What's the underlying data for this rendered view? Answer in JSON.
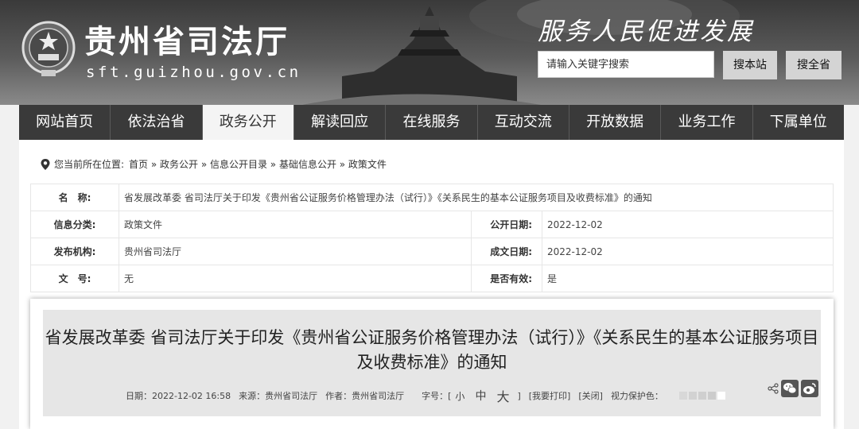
{
  "header": {
    "site_title": "贵州省司法厅",
    "site_domain": "sft.guizhou.gov.cn",
    "slogan": "服务人民促进发展"
  },
  "search": {
    "placeholder": "请输入关键字搜索",
    "btn_site": "搜本站",
    "btn_province": "搜全省"
  },
  "nav": {
    "items": [
      "网站首页",
      "依法治省",
      "政务公开",
      "解读回应",
      "在线服务",
      "互动交流",
      "开放数据",
      "业务工作",
      "下属单位"
    ],
    "active_index": 2
  },
  "breadcrumb": {
    "prefix": "您当前所在位置:",
    "path": "首页 » 政务公开 » 信息公开目录 » 基础信息公开 » 政策文件"
  },
  "info": {
    "name_label": "名　称:",
    "name_value": "省发展改革委 省司法厅关于印发《贵州省公证服务价格管理办法（试行）》《关系民生的基本公证服务项目及收费标准》的通知",
    "category_label": "信息分类:",
    "category_value": "政策文件",
    "publish_date_label": "公开日期:",
    "publish_date_value": "2022-12-02",
    "org_label": "发布机构:",
    "org_value": "贵州省司法厅",
    "written_date_label": "成文日期:",
    "written_date_value": "2022-12-02",
    "doc_no_label": "文　号:",
    "doc_no_value": "无",
    "valid_label": "是否有效:",
    "valid_value": "是"
  },
  "article": {
    "title": "省发展改革委 省司法厅关于印发《贵州省公证服务价格管理办法（试行）》《关系民生的基本公证服务项目及收费标准》的通知",
    "date": "日期：2022-12-02 16:58",
    "source": "来源：贵州省司法厅",
    "author": "作者：贵州省司法厅",
    "fontsize_label": "字号：[",
    "fs_small": "小",
    "fs_mid": "中",
    "fs_big": "大",
    "fontsize_end": "]",
    "print": "[我要打印]",
    "close": "[关闭]",
    "eye_care": "视力保护色：",
    "swatch_colors": [
      "#d8d8d8",
      "#d2d2d2",
      "#cfcfcf",
      "#cccccc",
      "#ffffff"
    ]
  },
  "icons": [
    "share-icon",
    "wechat-icon",
    "weibo-icon",
    "location-pin-icon",
    "national-emblem-icon"
  ]
}
